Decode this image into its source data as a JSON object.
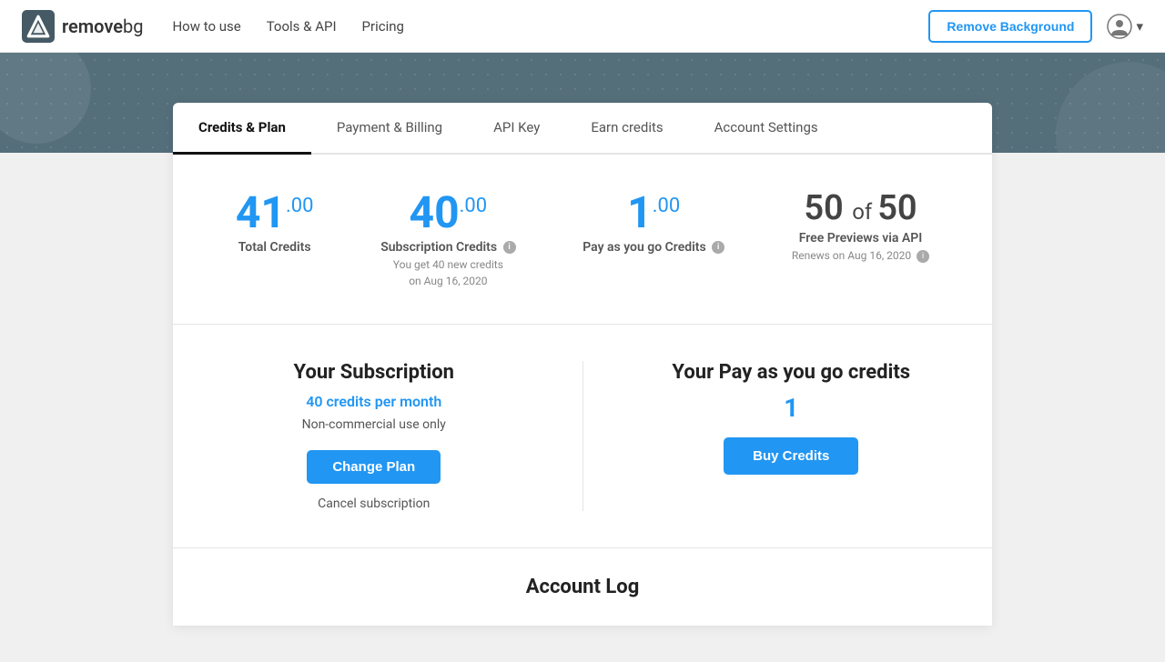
{
  "navbar": {
    "logo_text_remove": "remove",
    "logo_text_bg": "bg",
    "nav_links": [
      {
        "label": "How to use",
        "id": "how-to-use"
      },
      {
        "label": "Tools & API",
        "id": "tools-api"
      },
      {
        "label": "Pricing",
        "id": "pricing"
      }
    ],
    "remove_background_btn": "Remove Background",
    "account_dropdown": "▾"
  },
  "tabs": [
    {
      "label": "Credits & Plan",
      "active": true
    },
    {
      "label": "Payment & Billing",
      "active": false
    },
    {
      "label": "API Key",
      "active": false
    },
    {
      "label": "Earn credits",
      "active": false
    },
    {
      "label": "Account Settings",
      "active": false
    }
  ],
  "credits_overview": {
    "total_credits_number": "41",
    "total_credits_decimal": ".00",
    "total_credits_label": "Total Credits",
    "subscription_credits_number": "40",
    "subscription_credits_decimal": ".00",
    "subscription_credits_label": "Subscription Credits",
    "subscription_credits_sublabel": "You get 40 new credits",
    "subscription_credits_sublabel2": "on Aug 16, 2020",
    "payg_credits_number": "1",
    "payg_credits_decimal": ".00",
    "payg_credits_label": "Pay as you go Credits",
    "free_previews_count": "50",
    "free_previews_of": "of",
    "free_previews_total": "50",
    "free_previews_label": "Free Previews via API",
    "free_previews_renew": "Renews on Aug 16, 2020"
  },
  "subscription": {
    "title": "Your Subscription",
    "credits_per_month": "40 credits per month",
    "non_commercial": "Non-commercial use only",
    "change_plan_btn": "Change Plan",
    "cancel_link": "Cancel subscription"
  },
  "payg": {
    "title": "Your Pay as you go credits",
    "count": "1",
    "buy_credits_btn": "Buy Credits"
  },
  "account_log": {
    "title": "Account Log"
  }
}
